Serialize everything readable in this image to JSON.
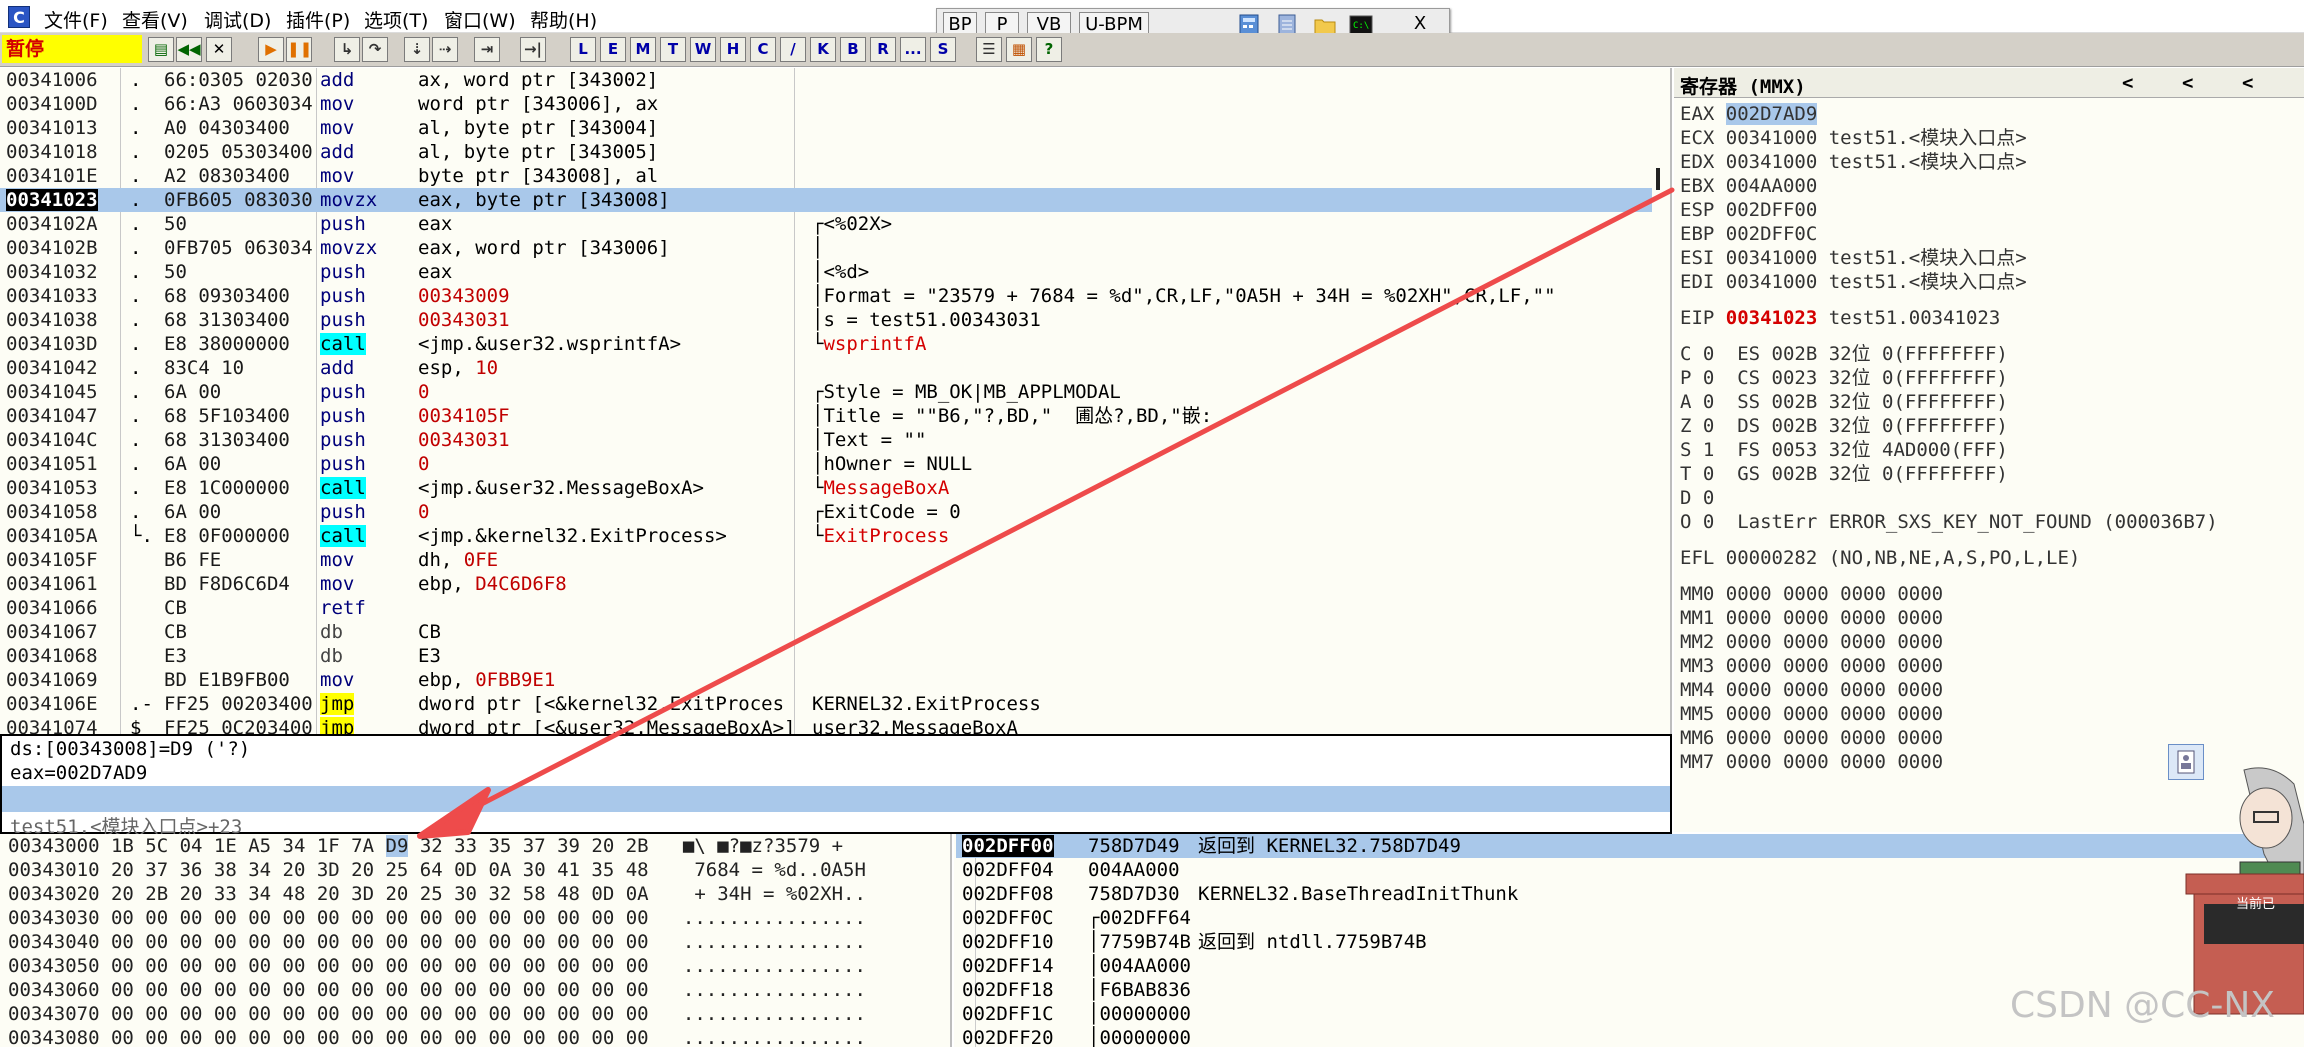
{
  "menubar": {
    "app_icon": "C",
    "items": [
      "文件(F)",
      "查看(V)",
      "调试(D)",
      "插件(P)",
      "选项(T)",
      "窗口(W)",
      "帮助(H)"
    ]
  },
  "floatbar": {
    "buttons": [
      "BP",
      "P",
      "VB",
      "U-BPM"
    ],
    "close": "X",
    "icons": [
      "calc-icon",
      "notes-icon",
      "folder-icon",
      "console-icon"
    ]
  },
  "toolbar": {
    "status": "暂停",
    "run_icons": [
      "open-icon",
      "rewind-icon",
      "close-icon",
      "run-icon",
      "pause-icon",
      "step-into-icon",
      "step-over-icon",
      "trace-into-icon",
      "trace-over-icon",
      "execute-till-return-icon",
      "goto-icon"
    ],
    "letters": [
      "L",
      "E",
      "M",
      "T",
      "W",
      "H",
      "C",
      "/",
      "K",
      "B",
      "R",
      "...",
      "S"
    ],
    "extra_icons": [
      "list-icon",
      "grid-icon",
      "help-icon"
    ]
  },
  "disasm": {
    "rows": [
      {
        "addr": "00341006",
        "mark": ".",
        "hex": "66:0305 02030",
        "mn": "add",
        "op": [
          [
            "ax, word ptr [343002]",
            ""
          ]
        ],
        "cm": []
      },
      {
        "addr": "0034100D",
        "mark": ".",
        "hex": "66:A3 0603034",
        "mn": "mov",
        "op": [
          [
            "word ptr [343006], ax",
            ""
          ]
        ],
        "cm": []
      },
      {
        "addr": "00341013",
        "mark": ".",
        "hex": "A0 04303400",
        "mn": "mov",
        "op": [
          [
            "al, byte ptr [343004]",
            ""
          ]
        ],
        "cm": []
      },
      {
        "addr": "00341018",
        "mark": ".",
        "hex": "0205 05303400",
        "mn": "add",
        "op": [
          [
            "al, byte ptr [343005]",
            ""
          ]
        ],
        "cm": []
      },
      {
        "addr": "0034101E",
        "mark": ".",
        "hex": "A2 08303400",
        "mn": "mov",
        "op": [
          [
            "byte ptr [343008], al",
            ""
          ]
        ],
        "cm": []
      },
      {
        "addr": "00341023",
        "mark": ".",
        "hex": "0FB605 083030",
        "mn": "movzx",
        "op": [
          [
            "eax, byte ptr [343008]",
            ""
          ]
        ],
        "cm": [],
        "sel": true,
        "cur": true
      },
      {
        "addr": "0034102A",
        "mark": ".",
        "hex": "50",
        "mn": "push",
        "op": [
          [
            "eax",
            ""
          ]
        ],
        "cm": [
          [
            "┌<%02X>",
            ""
          ]
        ]
      },
      {
        "addr": "0034102B",
        "mark": ".",
        "hex": "0FB705 063034",
        "mn": "movzx",
        "op": [
          [
            "eax, word ptr [343006]",
            ""
          ]
        ],
        "cm": [
          [
            "│",
            ""
          ]
        ]
      },
      {
        "addr": "00341032",
        "mark": ".",
        "hex": "50",
        "mn": "push",
        "op": [
          [
            "eax",
            ""
          ]
        ],
        "cm": [
          [
            "│<%d>",
            ""
          ]
        ]
      },
      {
        "addr": "00341033",
        "mark": ".",
        "hex": "68 09303400",
        "mn": "push",
        "op": [
          [
            "00343009",
            "num"
          ]
        ],
        "cm": [
          [
            "│Format = \"23579 + 7684 = %d\",CR,LF,\"0A5H + 34H = %02XH\",CR,LF,\"\"",
            ""
          ]
        ]
      },
      {
        "addr": "00341038",
        "mark": ".",
        "hex": "68 31303400",
        "mn": "push",
        "op": [
          [
            "00343031",
            "num"
          ]
        ],
        "cm": [
          [
            "│s = test51.00343031",
            ""
          ]
        ]
      },
      {
        "addr": "0034103D",
        "mark": ".",
        "hex": "E8 38000000",
        "mn": "call",
        "op": [
          [
            "<jmp.&user32.wsprintfA>",
            ""
          ]
        ],
        "cm": [
          [
            "└",
            ""
          ],
          [
            "wsprintfA",
            "cm-api"
          ]
        ]
      },
      {
        "addr": "00341042",
        "mark": ".",
        "hex": "83C4 10",
        "mn": "add",
        "op": [
          [
            "esp, ",
            ""
          ],
          [
            "10",
            "num"
          ]
        ],
        "cm": []
      },
      {
        "addr": "00341045",
        "mark": ".",
        "hex": "6A 00",
        "mn": "push",
        "op": [
          [
            "0",
            "num"
          ]
        ],
        "cm": [
          [
            "┌Style = MB_OK|MB_APPLMODAL",
            ""
          ]
        ]
      },
      {
        "addr": "00341047",
        "mark": ".",
        "hex": "68 5F103400",
        "mn": "push",
        "op": [
          [
            "0034105F",
            "num"
          ]
        ],
        "cm": [
          [
            "│Title = \"\"B6,\"?,BD,\"  圃怂?,BD,\"嵌:",
            ""
          ]
        ]
      },
      {
        "addr": "0034104C",
        "mark": ".",
        "hex": "68 31303400",
        "mn": "push",
        "op": [
          [
            "00343031",
            "num"
          ]
        ],
        "cm": [
          [
            "│Text = \"\"",
            ""
          ]
        ]
      },
      {
        "addr": "00341051",
        "mark": ".",
        "hex": "6A 00",
        "mn": "push",
        "op": [
          [
            "0",
            "num"
          ]
        ],
        "cm": [
          [
            "│hOwner = NULL",
            ""
          ]
        ]
      },
      {
        "addr": "00341053",
        "mark": ".",
        "hex": "E8 1C000000",
        "mn": "call",
        "op": [
          [
            "<jmp.&user32.MessageBoxA>",
            ""
          ]
        ],
        "cm": [
          [
            "└",
            ""
          ],
          [
            "MessageBoxA",
            "cm-api"
          ]
        ]
      },
      {
        "addr": "00341058",
        "mark": ".",
        "hex": "6A 00",
        "mn": "push",
        "op": [
          [
            "0",
            "num"
          ]
        ],
        "cm": [
          [
            "┌ExitCode = 0",
            ""
          ]
        ]
      },
      {
        "addr": "0034105A",
        "mark": "└.",
        "hex": "E8 0F000000",
        "mn": "call",
        "op": [
          [
            "<jmp.&kernel32.ExitProcess>",
            ""
          ]
        ],
        "cm": [
          [
            "└",
            ""
          ],
          [
            "ExitProcess",
            "cm-api"
          ]
        ]
      },
      {
        "addr": "0034105F",
        "mark": "",
        "hex": "B6 FE",
        "mn": "mov",
        "op": [
          [
            "dh, ",
            ""
          ],
          [
            "0FE",
            "num"
          ]
        ],
        "cm": []
      },
      {
        "addr": "00341061",
        "mark": "",
        "hex": "BD F8D6C6D4",
        "mn": "mov",
        "op": [
          [
            "ebp, ",
            ""
          ],
          [
            "D4C6D6F8",
            "num"
          ]
        ],
        "cm": []
      },
      {
        "addr": "00341066",
        "mark": "",
        "hex": "CB",
        "mn": "retf",
        "op": [],
        "cm": []
      },
      {
        "addr": "00341067",
        "mark": "",
        "hex": "CB",
        "mn": "db",
        "op": [
          [
            "CB",
            ""
          ]
        ],
        "cm": []
      },
      {
        "addr": "00341068",
        "mark": "",
        "hex": "E3",
        "mn": "db",
        "op": [
          [
            "E3",
            ""
          ]
        ],
        "cm": []
      },
      {
        "addr": "00341069",
        "mark": "",
        "hex": "BD E1B9FB00",
        "mn": "mov",
        "op": [
          [
            "ebp, ",
            ""
          ],
          [
            "0FBB9E1",
            "num"
          ]
        ],
        "cm": []
      },
      {
        "addr": "0034106E",
        "mark": ".-",
        "hex": "FF25 00203400",
        "mn": "jmp",
        "op": [
          [
            "dword ptr [<&kernel32.ExitProces",
            ""
          ]
        ],
        "cm": [
          [
            "KERNEL32.ExitProcess",
            ""
          ]
        ]
      },
      {
        "addr": "00341074",
        "mark": "$",
        "hex": "FF25 0C203400",
        "mn": "jmp",
        "op": [
          [
            "dword ptr [<&user32.MessageBoxA>]",
            ""
          ]
        ],
        "cm": [
          [
            "user32.MessageBoxA",
            ""
          ]
        ]
      }
    ]
  },
  "info": {
    "line1": "ds:[00343008]=D9 ('?)",
    "line2": "eax=002D7AD9",
    "line3": "test51.<模块入口点>+23"
  },
  "registers": {
    "title": "寄存器 (MMX)",
    "nav": [
      "<",
      "<",
      "<"
    ],
    "gp": [
      {
        "name": "EAX",
        "value": "002D7AD9",
        "note": "",
        "hl": true
      },
      {
        "name": "ECX",
        "value": "00341000",
        "note": "test51.<模块入口点>"
      },
      {
        "name": "EDX",
        "value": "00341000",
        "note": "test51.<模块入口点>"
      },
      {
        "name": "EBX",
        "value": "004AA000",
        "note": ""
      },
      {
        "name": "ESP",
        "value": "002DFF00",
        "note": ""
      },
      {
        "name": "EBP",
        "value": "002DFF0C",
        "note": ""
      },
      {
        "name": "ESI",
        "value": "00341000",
        "note": "test51.<模块入口点>"
      },
      {
        "name": "EDI",
        "value": "00341000",
        "note": "test51.<模块入口点>"
      }
    ],
    "eip": {
      "name": "EIP",
      "value": "00341023",
      "note": "test51.00341023"
    },
    "flags": [
      "C 0  ES 002B 32位 0(FFFFFFFF)",
      "P 0  CS 0023 32位 0(FFFFFFFF)",
      "A 0  SS 002B 32位 0(FFFFFFFF)",
      "Z 0  DS 002B 32位 0(FFFFFFFF)",
      "S 1  FS 0053 32位 4AD000(FFF)",
      "T 0  GS 002B 32位 0(FFFFFFFF)",
      "D 0",
      "O 0  LastErr ERROR_SXS_KEY_NOT_FOUND (000036B7)"
    ],
    "efl": "EFL 00000282 (NO,NB,NE,A,S,PO,L,LE)",
    "mmx": [
      "MM0 0000 0000 0000 0000",
      "MM1 0000 0000 0000 0000",
      "MM2 0000 0000 0000 0000",
      "MM3 0000 0000 0000 0000",
      "MM4 0000 0000 0000 0000",
      "MM5 0000 0000 0000 0000",
      "MM6 0000 0000 0000 0000",
      "MM7 0000 0000 0000 0000"
    ]
  },
  "dump": {
    "rows": [
      {
        "addr": "00343000",
        "pre": "1B 5C 04 1E A5 34 1F 7A ",
        "sel": "D9",
        "post": " 32 33 35 37 39 20 2B",
        "ascii": "■\\ ■?■z?3579 +"
      },
      {
        "addr": "00343010",
        "pre": "20 37 36 38 34 20 3D 20 25 64 0D 0A 30 41 35 48",
        "sel": "",
        "post": "",
        "ascii": " 7684 = %d..0A5H"
      },
      {
        "addr": "00343020",
        "pre": "20 2B 20 33 34 48 20 3D 20 25 30 32 58 48 0D 0A",
        "sel": "",
        "post": "",
        "ascii": " + 34H = %02XH.."
      },
      {
        "addr": "00343030",
        "pre": "00 00 00 00 00 00 00 00 00 00 00 00 00 00 00 00",
        "sel": "",
        "post": "",
        "ascii": "................"
      },
      {
        "addr": "00343040",
        "pre": "00 00 00 00 00 00 00 00 00 00 00 00 00 00 00 00",
        "sel": "",
        "post": "",
        "ascii": "................"
      },
      {
        "addr": "00343050",
        "pre": "00 00 00 00 00 00 00 00 00 00 00 00 00 00 00 00",
        "sel": "",
        "post": "",
        "ascii": "................"
      },
      {
        "addr": "00343060",
        "pre": "00 00 00 00 00 00 00 00 00 00 00 00 00 00 00 00",
        "sel": "",
        "post": "",
        "ascii": "................"
      },
      {
        "addr": "00343070",
        "pre": "00 00 00 00 00 00 00 00 00 00 00 00 00 00 00 00",
        "sel": "",
        "post": "",
        "ascii": "................"
      },
      {
        "addr": "00343080",
        "pre": "00 00 00 00 00 00 00 00 00 00 00 00 00 00 00 00",
        "sel": "",
        "post": "",
        "ascii": "................"
      }
    ]
  },
  "stack": {
    "rows": [
      {
        "addr": "002DFF00",
        "val": "758D7D49",
        "cm": "返回到 KERNEL32.758D7D49",
        "top": true,
        "sel": true
      },
      {
        "addr": "002DFF04",
        "val": "004AA000",
        "cm": ""
      },
      {
        "addr": "002DFF08",
        "val": "758D7D30",
        "cm": "KERNEL32.BaseThreadInitThunk"
      },
      {
        "addr": "002DFF0C",
        "val": "┌002DFF64",
        "cm": ""
      },
      {
        "addr": "002DFF10",
        "val": "│7759B74B",
        "cm": "返回到 ntdll.7759B74B"
      },
      {
        "addr": "002DFF14",
        "val": "│004AA000",
        "cm": ""
      },
      {
        "addr": "002DFF18",
        "val": "│F6BAB836",
        "cm": ""
      },
      {
        "addr": "002DFF1C",
        "val": "│00000000",
        "cm": ""
      },
      {
        "addr": "002DFF20",
        "val": "│00000000",
        "cm": ""
      }
    ]
  },
  "watermark": "CSDN @CC-NX",
  "mascot_badge": "当前已",
  "colors": {
    "selection": "#a9c8ea",
    "call_bg": "#00ffff",
    "jmp_bg": "#ffff00",
    "api_red": "#d40000",
    "arrow": "#ee4b4b"
  }
}
